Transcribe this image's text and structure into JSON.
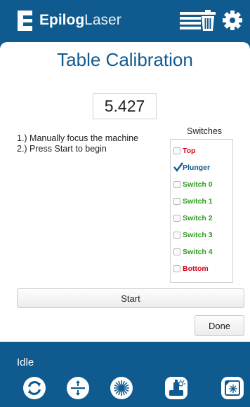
{
  "header": {
    "logo_bold": "Epilog",
    "logo_light": "Laser",
    "icons": [
      "logo-mark-icon",
      "menu-icon",
      "trash-icon",
      "gear-icon"
    ]
  },
  "title": "Table Calibration",
  "value": "5.427",
  "instructions": [
    "1.) Manually focus the machine",
    "2.) Press Start to begin"
  ],
  "switches": {
    "title": "Switches",
    "items": [
      {
        "label": "Top",
        "checked": false,
        "color": "#d0021b"
      },
      {
        "label": "Plunger",
        "checked": true,
        "color": "#0f5a8e"
      },
      {
        "label": "Switch 0",
        "checked": false,
        "color": "#2e9b1f"
      },
      {
        "label": "Switch 1",
        "checked": false,
        "color": "#2e9b1f"
      },
      {
        "label": "Switch 2",
        "checked": false,
        "color": "#2e9b1f"
      },
      {
        "label": "Switch 3",
        "checked": false,
        "color": "#2e9b1f"
      },
      {
        "label": "Switch 4",
        "checked": false,
        "color": "#2e9b1f"
      },
      {
        "label": "Bottom",
        "checked": false,
        "color": "#d0021b"
      }
    ]
  },
  "buttons": {
    "start": "Start",
    "done": "Done"
  },
  "status": "Idle",
  "footer_icons": [
    "refresh-icon",
    "focus-icon",
    "laser-icon",
    "job-icon",
    "frame-icon"
  ],
  "colors": {
    "brand_blue": "#0f5a8e",
    "title_blue": "#135a8f",
    "alert_red": "#d0021b",
    "switch_green": "#2e9b1f"
  }
}
